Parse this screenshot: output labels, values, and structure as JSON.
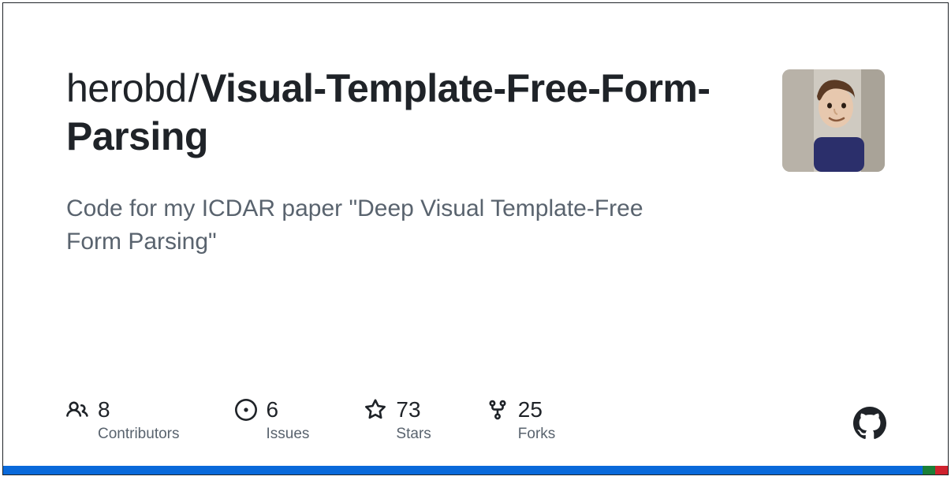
{
  "repo": {
    "owner": "herobd",
    "name": "Visual-Template-Free-Form-Parsing",
    "description": "Code for my ICDAR paper \"Deep Visual Template-Free Form Parsing\""
  },
  "stats": {
    "contributors": {
      "count": "8",
      "label": "Contributors"
    },
    "issues": {
      "count": "6",
      "label": "Issues"
    },
    "stars": {
      "count": "73",
      "label": "Stars"
    },
    "forks": {
      "count": "25",
      "label": "Forks"
    }
  }
}
